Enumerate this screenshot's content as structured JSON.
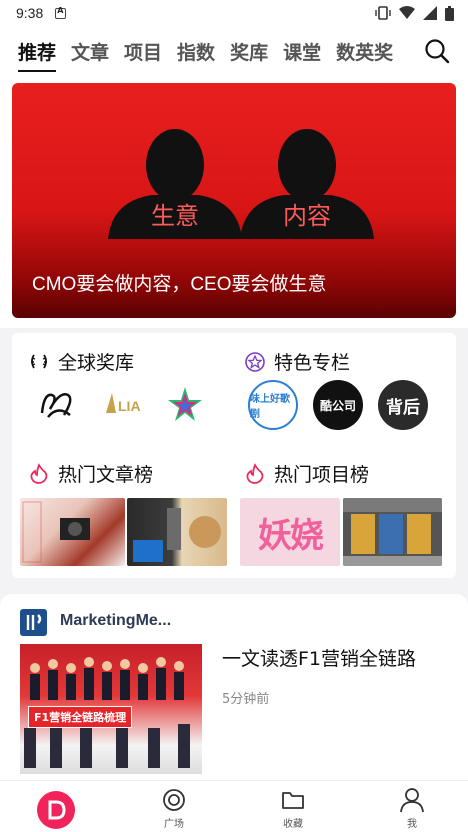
{
  "status": {
    "time": "9:38"
  },
  "nav": {
    "tabs": [
      "推荐",
      "文章",
      "项目",
      "指数",
      "奖库",
      "课堂",
      "数英奖"
    ],
    "active_index": 0
  },
  "hero": {
    "caption": "CMO要会做内容，CEO要会做生意",
    "left_label": "生意",
    "right_label": "内容"
  },
  "sections": {
    "awards": {
      "title": "全球奖库",
      "logos": [
        "D&AD",
        "LIA",
        "star"
      ]
    },
    "columns": {
      "title": "特色专栏",
      "logos": [
        "味上好歌剧",
        "酷公司",
        "背后"
      ]
    },
    "hot_articles": {
      "title": "热门文章榜"
    },
    "hot_projects": {
      "title": "热门项目榜",
      "thumb_text": "妖娆"
    }
  },
  "article": {
    "source": "MarketingMe...",
    "title": "一文读透F1营销全链路",
    "time": "5分钟前",
    "image_banner": "F1营销全链路梳理"
  },
  "bottom_nav": {
    "items": [
      {
        "label": ""
      },
      {
        "label": "广场"
      },
      {
        "label": "收藏"
      },
      {
        "label": "我"
      }
    ]
  },
  "colors": {
    "accent": "#f0235a",
    "hero_red": "#e81f1f"
  }
}
